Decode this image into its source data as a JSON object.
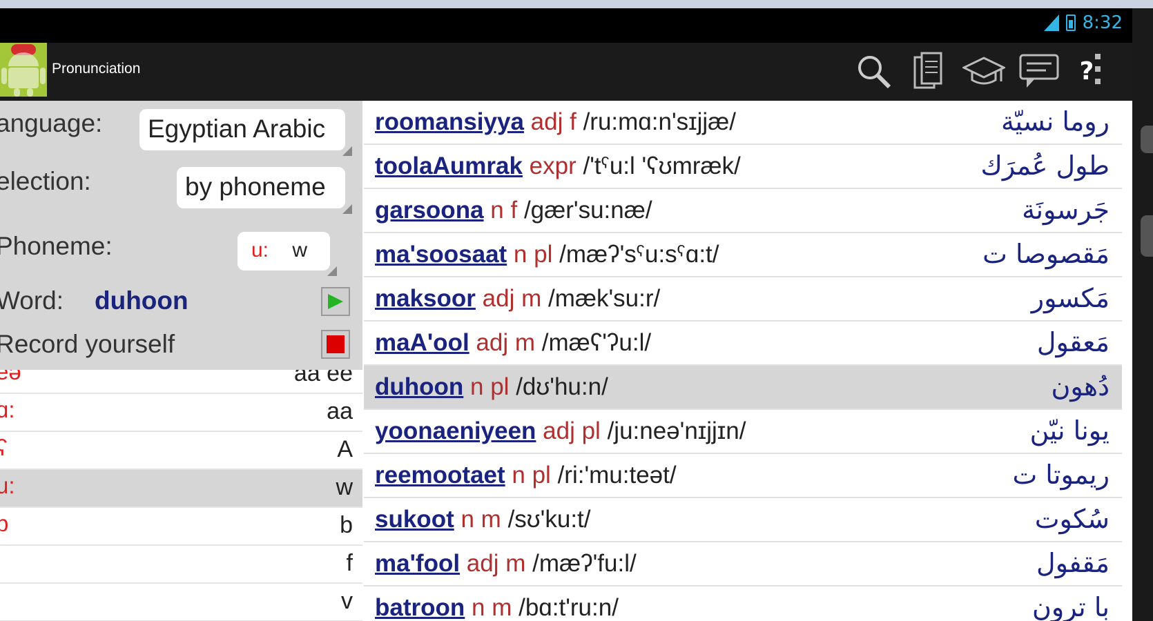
{
  "status": {
    "time": "8:32"
  },
  "app": {
    "title": "Pronunciation"
  },
  "actions": [
    {
      "name": "search-icon"
    },
    {
      "name": "documents-icon"
    },
    {
      "name": "graduation-cap-icon"
    },
    {
      "name": "chat-icon"
    },
    {
      "name": "help-icon",
      "label": "?"
    }
  ],
  "settings": {
    "language_label": "anguage:",
    "language_value": "Egyptian Arabic",
    "selection_label": "election:",
    "selection_value": "by phoneme",
    "phoneme_label": "Phoneme:",
    "phoneme_ipa": "u:",
    "phoneme_letter": "w",
    "word_label": "Word:",
    "word_value": "duhoon",
    "record_label": "Record yourself"
  },
  "phonemes": [
    {
      "ipa": "eə",
      "letter": "aa ee"
    },
    {
      "ipa": "ɑ:",
      "letter": "aa"
    },
    {
      "ipa": "ʕ",
      "letter": "A"
    },
    {
      "ipa": "u:",
      "letter": "w",
      "selected": true
    },
    {
      "ipa": "b",
      "letter": "b"
    },
    {
      "ipa": "",
      "letter": "f"
    },
    {
      "ipa": "'",
      "letter": "v"
    }
  ],
  "words": [
    {
      "word": "roomansiyya",
      "pos": "adj f",
      "ipa": "/ru:mɑ:n'sɪjjæ/",
      "arabic": "روما نسيّة"
    },
    {
      "word": "toolaAumrak",
      "pos": "expr",
      "ipa": "/'tˤu:l 'ʕʊmræk/",
      "arabic": "طول عُمرَك"
    },
    {
      "word": "garsoona",
      "pos": "n f",
      "ipa": "/gær'su:næ/",
      "arabic": "جَرسونَة"
    },
    {
      "word": "ma'soosaat",
      "pos": "n pl",
      "ipa": "/mæʔ'sˤu:sˤɑ:t/",
      "arabic": "مَقصوصا ت"
    },
    {
      "word": "maksoor",
      "pos": "adj m",
      "ipa": "/mæk'su:r/",
      "arabic": "مَكسور"
    },
    {
      "word": "maA'ool",
      "pos": "adj m",
      "ipa": "/mæʕ'ʔu:l/",
      "arabic": "مَعقول"
    },
    {
      "word": "duhoon",
      "pos": "n pl",
      "ipa": "/dʊ'hu:n/",
      "arabic": "دُهون",
      "selected": true
    },
    {
      "word": "yoonaeniyeen",
      "pos": "adj pl",
      "ipa": "/ju:neə'nɪjjɪn/",
      "arabic": "يونا نيّن"
    },
    {
      "word": "reemootaet",
      "pos": "n pl",
      "ipa": "/ri:'mu:teət/",
      "arabic": "ريموتا ت"
    },
    {
      "word": "sukoot",
      "pos": "n m",
      "ipa": "/sʊ'ku:t/",
      "arabic": "سُكوت"
    },
    {
      "word": "ma'fool",
      "pos": "adj m",
      "ipa": "/mæʔ'fu:l/",
      "arabic": "مَقفول"
    },
    {
      "word": "batroon",
      "pos": "n m",
      "ipa": "/bɑ:t'ru:n/",
      "arabic": "با ترون"
    }
  ]
}
